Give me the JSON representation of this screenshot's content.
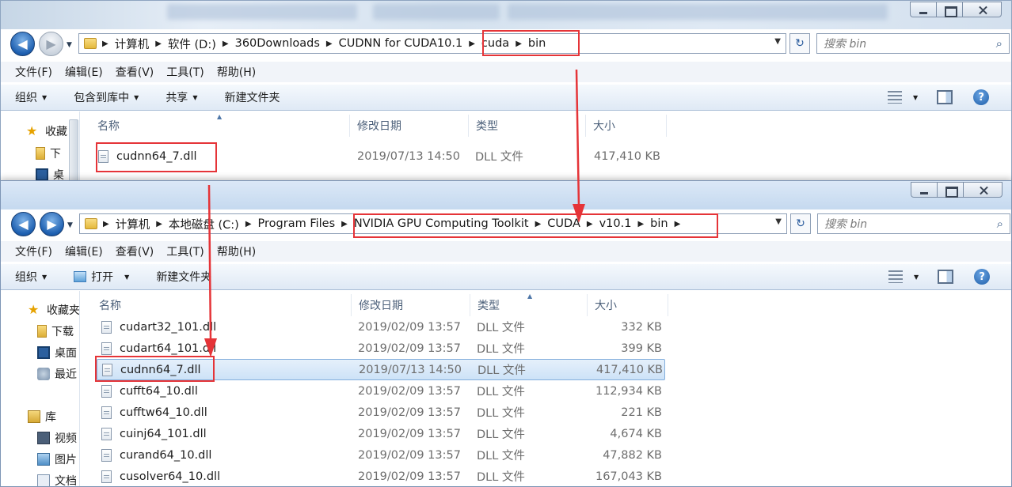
{
  "colors": {
    "highlight": "#e53438",
    "selected_row": "#cde2f7",
    "accent_blue": "#1d5fb0"
  },
  "menu": [
    "文件(F)",
    "编辑(E)",
    "查看(V)",
    "工具(T)",
    "帮助(H)"
  ],
  "columns": {
    "name": "名称",
    "date": "修改日期",
    "type": "类型",
    "size": "大小"
  },
  "back_window": {
    "breadcrumb": [
      "计算机",
      "软件 (D:)",
      "360Downloads",
      "CUDNN for CUDA10.1",
      "cuda",
      "bin"
    ],
    "search_placeholder": "搜索 bin",
    "commands": [
      "组织",
      "包含到库中",
      "共享",
      "新建文件夹"
    ],
    "nav": [
      "收藏",
      "下",
      "桌"
    ],
    "files": [
      {
        "name": "cudnn64_7.dll",
        "date": "2019/07/13 14:50",
        "type": "DLL 文件",
        "size": "417,410 KB"
      }
    ]
  },
  "front_window": {
    "breadcrumb": [
      "计算机",
      "本地磁盘 (C:)",
      "Program Files",
      "NVIDIA GPU Computing Toolkit",
      "CUDA",
      "v10.1",
      "bin"
    ],
    "search_placeholder": "搜索 bin",
    "commands": [
      "组织",
      "打开",
      "新建文件夹"
    ],
    "nav": [
      "收藏夹",
      "下载",
      "桌面",
      "最近",
      "库",
      "视频",
      "图片",
      "文档"
    ],
    "files": [
      {
        "name": "cudart32_101.dll",
        "date": "2019/02/09 13:57",
        "type": "DLL 文件",
        "size": "332 KB"
      },
      {
        "name": "cudart64_101.dll",
        "date": "2019/02/09 13:57",
        "type": "DLL 文件",
        "size": "399 KB"
      },
      {
        "name": "cudnn64_7.dll",
        "date": "2019/07/13 14:50",
        "type": "DLL 文件",
        "size": "417,410 KB"
      },
      {
        "name": "cufft64_10.dll",
        "date": "2019/02/09 13:57",
        "type": "DLL 文件",
        "size": "112,934 KB"
      },
      {
        "name": "cufftw64_10.dll",
        "date": "2019/02/09 13:57",
        "type": "DLL 文件",
        "size": "221 KB"
      },
      {
        "name": "cuinj64_101.dll",
        "date": "2019/02/09 13:57",
        "type": "DLL 文件",
        "size": "4,674 KB"
      },
      {
        "name": "curand64_10.dll",
        "date": "2019/02/09 13:57",
        "type": "DLL 文件",
        "size": "47,882 KB"
      },
      {
        "name": "cusolver64_10.dll",
        "date": "2019/02/09 13:57",
        "type": "DLL 文件",
        "size": "167,043 KB"
      }
    ]
  }
}
